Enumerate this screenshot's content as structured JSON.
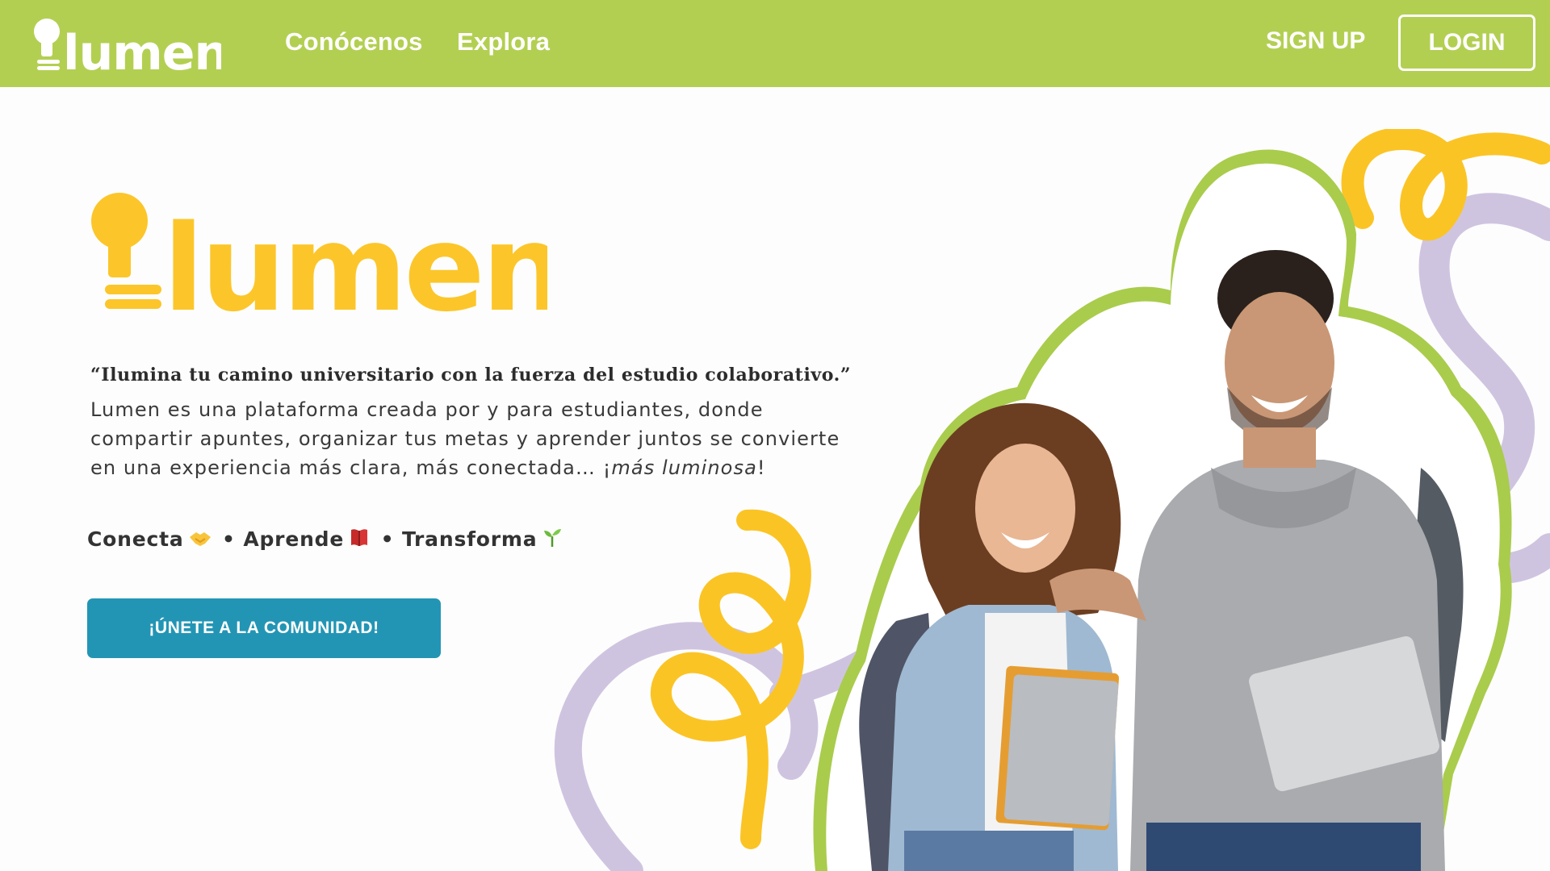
{
  "header": {
    "logo_text": "lumen",
    "nav": [
      {
        "label": "Conócenos"
      },
      {
        "label": "Explora"
      }
    ],
    "signup_label": "SIGN UP",
    "login_label": "LOGIN"
  },
  "hero": {
    "logo_text": "lumen",
    "quote": "“Ilumina tu camino universitario con la fuerza del estudio colaborativo.”",
    "description_lines": [
      "Lumen es una plataforma creada por y para estudiantes, donde",
      "compartir apuntes, organizar tus metas y aprender juntos se convierte",
      "en una experiencia más clara, más conectada… ¡"
    ],
    "description_em": "más luminosa",
    "description_end": "!",
    "tagline": {
      "word1": "Conecta",
      "word2": "Aprende",
      "word3": "Transforma",
      "separator": "•",
      "icons": [
        "handshake-icon",
        "book-icon",
        "seedling-icon"
      ]
    },
    "cta_label": "¡ÚNETE A LA COMUNIDAD!"
  },
  "colors": {
    "header_bg": "#b3cf52",
    "logo_yellow": "#fcc62a",
    "cta_blue": "#2395b4",
    "squiggle_yellow": "#fbc425",
    "squiggle_lilac": "#cfc4e0",
    "outline_green": "#a9cc4c"
  }
}
